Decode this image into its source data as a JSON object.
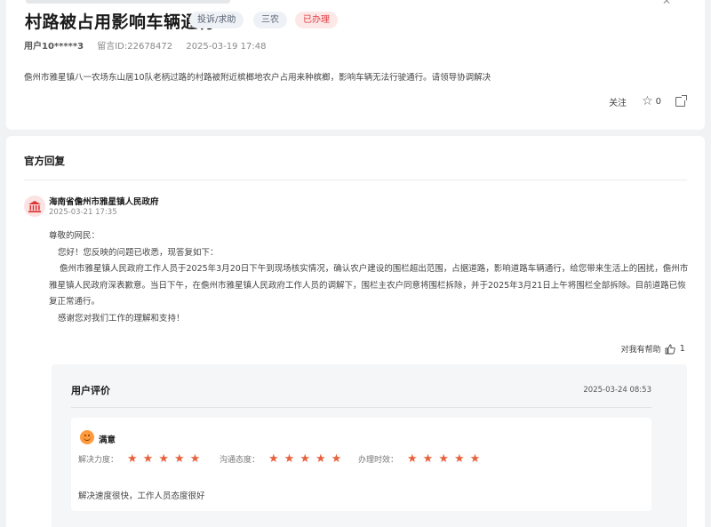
{
  "post": {
    "title": "村路被占用影响车辆通行",
    "tags": [
      "投诉/求助",
      "三农",
      "已办理"
    ],
    "user": "用户10*****3",
    "message_id": "留言ID:22678472",
    "datetime": "2025-03-19 17:48",
    "content": "儋州市雅星镇八一农场东山居10队老柄过路的村路被附近槟榔地农户占用来种槟榔，影响车辆无法行驶通行。请领导协调解决",
    "follow_label": "关注",
    "star_count": "0",
    "icons": {
      "star": "star-icon",
      "share": "share-icon",
      "close": "close-icon"
    }
  },
  "reply": {
    "section_title": "官方回复",
    "org_name": "海南省儋州市雅星镇人民政府",
    "date": "2025-03-21 17:35",
    "greeting": "尊敬的网民：",
    "line1": "您好！您反映的问题已收悉，现答复如下：",
    "line2": "儋州市雅星镇人民政府工作人员于2025年3月20日下午到现场核实情况，确认农户建设的围栏超出范围，占据道路，影响道路车辆通行，给您带来生活上的困扰，儋州市雅星镇人民政府深表歉意。当日下午，在儋州市雅星镇人民政府工作人员的调解下，围栏主农户同意将围栏拆除，并于2025年3月21日上午将围栏全部拆除。目前道路已恢复正常通行。",
    "line3": "感谢您对我们工作的理解和支持！",
    "helpful_label": "对我有帮助",
    "helpful_count": "1",
    "icons": {
      "org": "government-building-icon",
      "thumb": "thumbs-up-icon"
    }
  },
  "evaluation": {
    "title": "用户评价",
    "date": "2025-03-24 08:53",
    "satisfaction": "满意",
    "ratings": [
      {
        "label": "解决力度：",
        "stars": 5
      },
      {
        "label": "沟通态度：",
        "stars": 5
      },
      {
        "label": "办理时效：",
        "stars": 5
      }
    ],
    "comment": "解决速度很快，工作人员态度很好",
    "star_color": "#e8603c"
  }
}
